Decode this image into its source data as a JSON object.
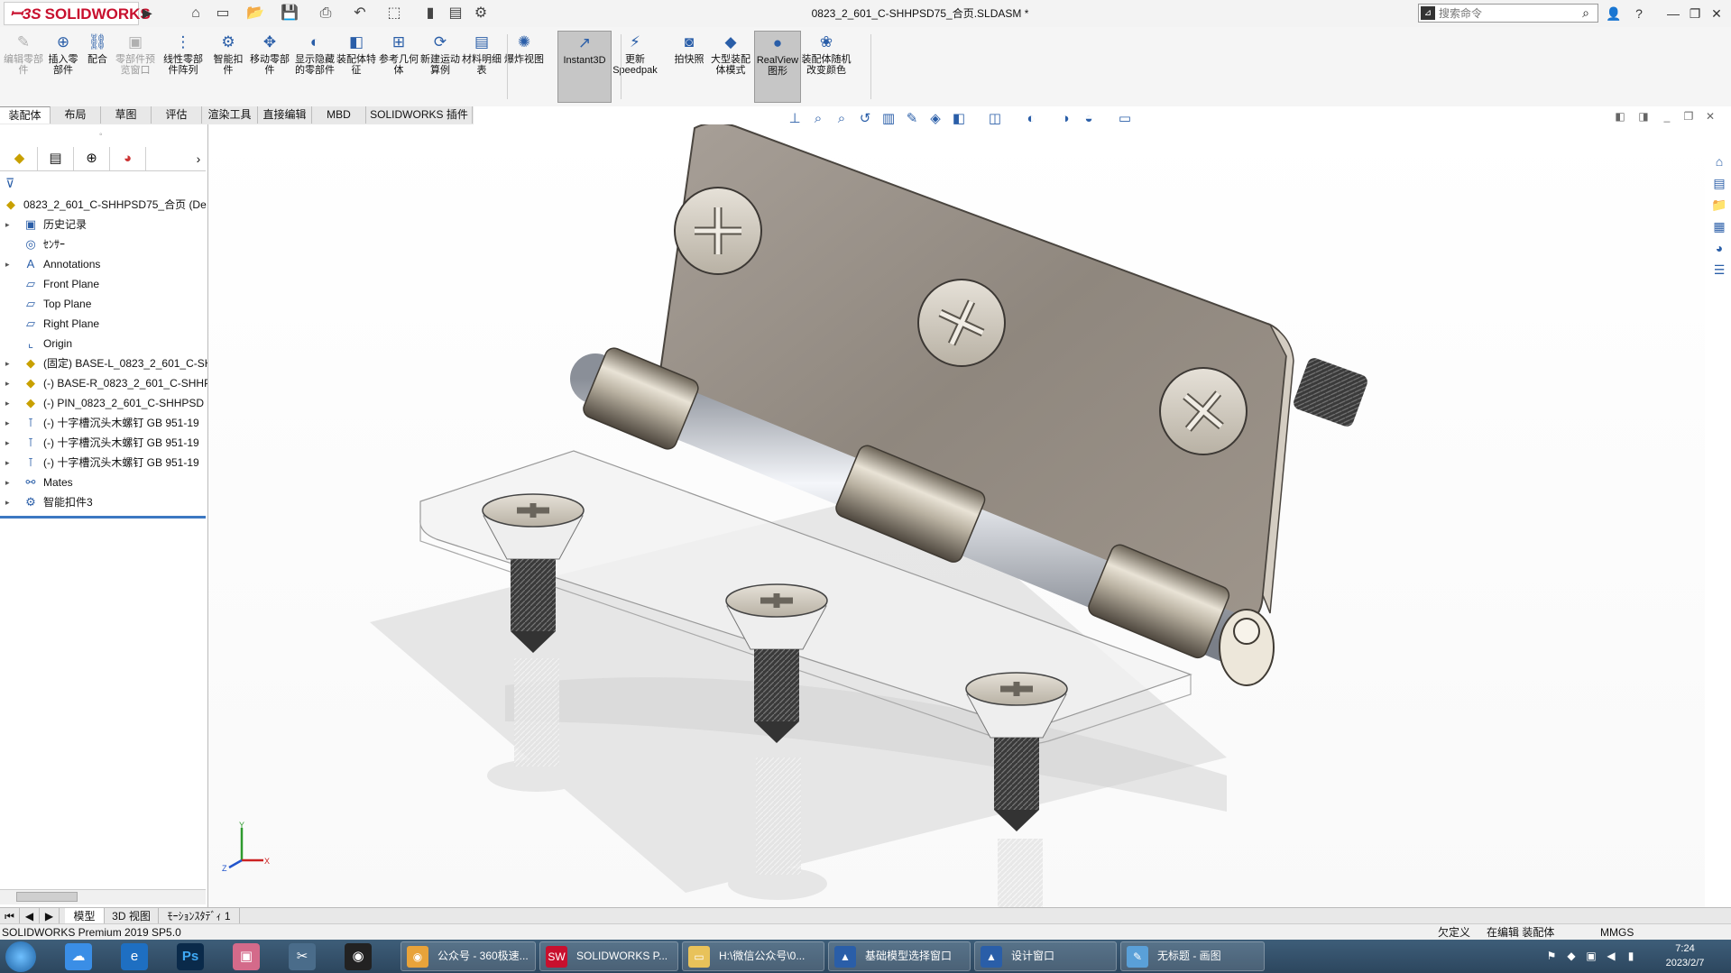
{
  "app": {
    "logo_text": "SOLIDWORKS",
    "document_title": "0823_2_601_C-SHHPSD75_合页.SLDASM *",
    "search_placeholder": "搜索命令",
    "help_label": "?"
  },
  "command_manager": {
    "items": [
      {
        "label": "编辑零部件",
        "icon": "edit-component-icon",
        "enabled": false
      },
      {
        "label": "插入零部件",
        "icon": "insert-component-icon",
        "enabled": true
      },
      {
        "label": "配合",
        "icon": "mate-icon",
        "enabled": true
      },
      {
        "label": "零部件预览窗口",
        "icon": "component-preview-icon",
        "enabled": false
      },
      {
        "label": "线性零部件阵列",
        "icon": "linear-pattern-icon",
        "enabled": true
      },
      {
        "label": "智能扣件",
        "icon": "smart-fasteners-icon",
        "enabled": true
      },
      {
        "label": "移动零部件",
        "icon": "move-component-icon",
        "enabled": true
      },
      {
        "label": "显示隐藏的零部件",
        "icon": "show-hidden-icon",
        "enabled": true
      },
      {
        "label": "装配体特征",
        "icon": "assembly-features-icon",
        "enabled": true
      },
      {
        "label": "参考几何体",
        "icon": "reference-geometry-icon",
        "enabled": true
      },
      {
        "label": "新建运动算例",
        "icon": "motion-study-icon",
        "enabled": true
      },
      {
        "label": "材料明细表",
        "icon": "bom-icon",
        "enabled": true
      },
      {
        "label": "爆炸视图",
        "icon": "exploded-view-icon",
        "enabled": true
      },
      {
        "label": "Instant3D",
        "icon": "instant3d-icon",
        "enabled": true,
        "selected": true
      },
      {
        "label": "更新Speedpak",
        "icon": "speedpak-icon",
        "enabled": true
      },
      {
        "label": "拍快照",
        "icon": "snapshot-icon",
        "enabled": true
      },
      {
        "label": "大型装配体模式",
        "icon": "large-assembly-icon",
        "enabled": true
      },
      {
        "label": "RealView图形",
        "icon": "realview-icon",
        "enabled": true,
        "selected": true
      },
      {
        "label": "装配体随机改变颜色",
        "icon": "random-color-icon",
        "enabled": true
      }
    ]
  },
  "tabs": [
    "装配体",
    "布局",
    "草图",
    "评估",
    "渲染工具",
    "直接编辑",
    "MBD",
    "SOLIDWORKS 插件"
  ],
  "tree": {
    "root": "0823_2_601_C-SHHPSD75_合页  (De",
    "items": [
      {
        "label": "历史记录",
        "icon": "history-icon",
        "expandable": true
      },
      {
        "label": "ｾﾝｻｰ",
        "icon": "sensor-icon",
        "expandable": false
      },
      {
        "label": "Annotations",
        "icon": "annotations-icon",
        "expandable": true
      },
      {
        "label": "Front Plane",
        "icon": "plane-icon",
        "expandable": false
      },
      {
        "label": "Top Plane",
        "icon": "plane-icon",
        "expandable": false
      },
      {
        "label": "Right Plane",
        "icon": "plane-icon",
        "expandable": false
      },
      {
        "label": "Origin",
        "icon": "origin-icon",
        "expandable": false
      },
      {
        "label": "(固定) BASE-L_0823_2_601_C-SH",
        "icon": "part-icon",
        "expandable": true
      },
      {
        "label": "(-) BASE-R_0823_2_601_C-SHHP",
        "icon": "part-icon",
        "expandable": true
      },
      {
        "label": "(-) PIN_0823_2_601_C-SHHPSD",
        "icon": "part-icon",
        "expandable": true
      },
      {
        "label": "(-) 十字槽沉头木螺钉 GB 951-19",
        "icon": "screw-icon",
        "expandable": true
      },
      {
        "label": "(-) 十字槽沉头木螺钉 GB 951-19",
        "icon": "screw-icon",
        "expandable": true
      },
      {
        "label": "(-) 十字槽沉头木螺钉 GB 951-19",
        "icon": "screw-icon",
        "expandable": true
      },
      {
        "label": "Mates",
        "icon": "mates-icon",
        "expandable": true
      },
      {
        "label": "智能扣件3",
        "icon": "smart-fastener-icon",
        "expandable": true
      }
    ]
  },
  "bottom_tabs": [
    "模型",
    "3D 视图",
    "ﾓｰｼｮﾝｽﾀﾃﾞｨ 1"
  ],
  "status": {
    "product": "SOLIDWORKS Premium 2019 SP5.0",
    "defined": "欠定义",
    "editing": "在编辑 装配体",
    "units": "MMGS"
  },
  "taskbar": {
    "tasks": [
      {
        "label": "公众号 - 360极速...",
        "icon": "browser-360-icon"
      },
      {
        "label": "SOLIDWORKS P...",
        "icon": "solidworks-icon"
      },
      {
        "label": "H:\\微信公众号\\0...",
        "icon": "folder-icon"
      },
      {
        "label": "基础模型选择窗口",
        "icon": "app-window-icon"
      },
      {
        "label": "设计窗口",
        "icon": "app-window-icon"
      },
      {
        "label": "无标题 - 画图",
        "icon": "paint-icon"
      }
    ],
    "time": "7:24",
    "date": "2023/2/7"
  },
  "colors": {
    "brand": "#c8102e",
    "accent": "#3c78c2",
    "taskbar": "#2c465e"
  }
}
